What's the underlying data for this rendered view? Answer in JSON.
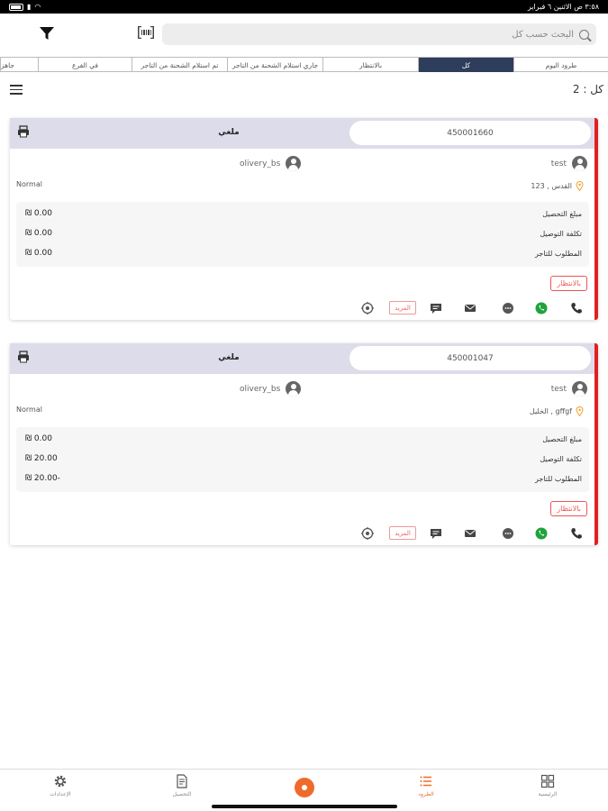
{
  "status_bar": {
    "time_date": "٣:٥٨ ص   الاثنين ٦ فبراير"
  },
  "search": {
    "placeholder": "البحث حسب كل"
  },
  "tabs": [
    {
      "label": "طرود اليوم"
    },
    {
      "label": "كل",
      "active": true
    },
    {
      "label": "بالانتظار"
    },
    {
      "label": "جاري استلام الشحنة من التاجر"
    },
    {
      "label": "تم استلام الشحنة من التاجر"
    },
    {
      "label": "في الفرع"
    },
    {
      "label": "جاهز"
    }
  ],
  "count_label": "كل : 2",
  "cards": [
    {
      "id": "450001660",
      "status": "ملغي",
      "customer": "test",
      "driver": "olivery_bs",
      "priority": "Normal",
      "location": "القدس , 123",
      "amounts": [
        {
          "label": "مبلغ التحصيل",
          "value": "₪ 0.00"
        },
        {
          "label": "تكلفة التوصيل",
          "value": "₪ 0.00"
        },
        {
          "label": "المطلوب للتاجر",
          "value": "₪ 0.00"
        }
      ],
      "status_button": "بالانتظار",
      "more_label": "المزيد"
    },
    {
      "id": "450001047",
      "status": "ملغي",
      "customer": "test",
      "driver": "olivery_bs",
      "priority": "Normal",
      "location": "الخليل , gffgf",
      "amounts": [
        {
          "label": "مبلغ التحصيل",
          "value": "₪ 0.00"
        },
        {
          "label": "تكلفة التوصيل",
          "value": "₪ 20.00"
        },
        {
          "label": "المطلوب للتاجر",
          "value": "₪ 20.00-"
        }
      ],
      "status_button": "بالانتظار",
      "more_label": "المزيد"
    }
  ],
  "bottom_nav": {
    "settings": "الإعدادات",
    "collection": "التحصيل",
    "orders": "الطرود",
    "dashboard": "الرئيسية"
  },
  "colors": {
    "accent": "#ef6b2b",
    "active_tab": "#2f3d5c",
    "card_border": "#e02020",
    "header_bg": "#dcdcea"
  }
}
